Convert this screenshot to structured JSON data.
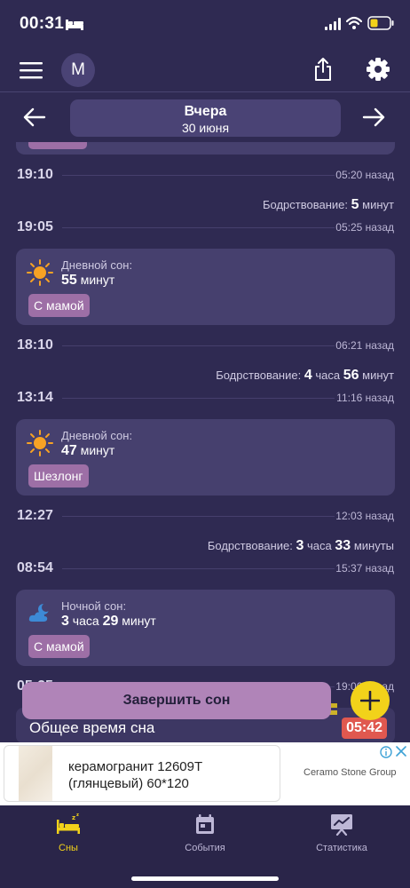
{
  "status_bar": {
    "time": "00:31"
  },
  "header": {
    "avatar_initial": "M"
  },
  "date_nav": {
    "title": "Вчера",
    "date": "30 июня"
  },
  "timeline": [
    {
      "kind": "time",
      "time": "19:10",
      "ago": "05:20 назад"
    },
    {
      "kind": "awake",
      "label": "Бодрствование:",
      "parts": [
        "5",
        "минут"
      ]
    },
    {
      "kind": "time",
      "time": "19:05",
      "ago": "05:25 назад"
    },
    {
      "kind": "sleep",
      "icon": "sun-icon",
      "type_label": "Дневной сон:",
      "parts": [
        "55",
        "минут"
      ],
      "tag": "С мамой"
    },
    {
      "kind": "time",
      "time": "18:10",
      "ago": "06:21 назад"
    },
    {
      "kind": "awake",
      "label": "Бодрствование:",
      "parts": [
        "4",
        "часа",
        "56",
        "минут"
      ]
    },
    {
      "kind": "time",
      "time": "13:14",
      "ago": "11:16 назад"
    },
    {
      "kind": "sleep",
      "icon": "sun-icon",
      "type_label": "Дневной сон:",
      "parts": [
        "47",
        "минут"
      ],
      "tag": "Шезлонг"
    },
    {
      "kind": "time",
      "time": "12:27",
      "ago": "12:03 назад"
    },
    {
      "kind": "awake",
      "label": "Бодрствование:",
      "parts": [
        "3",
        "часа",
        "33",
        "минуты"
      ]
    },
    {
      "kind": "time",
      "time": "08:54",
      "ago": "15:37 назад"
    },
    {
      "kind": "sleep",
      "icon": "moon-cloud-icon",
      "type_label": "Ночной сон:",
      "parts": [
        "3",
        "часа",
        "29",
        "минут"
      ],
      "tag": "С мамой"
    },
    {
      "kind": "time",
      "time": "05:25",
      "ago": "19:06 назад"
    }
  ],
  "summary": {
    "label": "Общее время сна",
    "value": "05:42"
  },
  "actions": {
    "finish_sleep": "Завершить сон"
  },
  "ad": {
    "title": "керамогранит 12609T (глянцевый) 60*120",
    "brand": "Ceramo Stone Group"
  },
  "tabs": [
    {
      "label": "Сны",
      "icon": "sleep-bed-icon",
      "active": true
    },
    {
      "label": "События",
      "icon": "calendar-icon",
      "active": false
    },
    {
      "label": "Статистика",
      "icon": "statistics-icon",
      "active": false
    }
  ],
  "colors": {
    "background": "#2f2a52",
    "card": "#46406e",
    "tag": "#9d6fa6",
    "accent": "#f2d21a",
    "badge": "#e0584f"
  }
}
